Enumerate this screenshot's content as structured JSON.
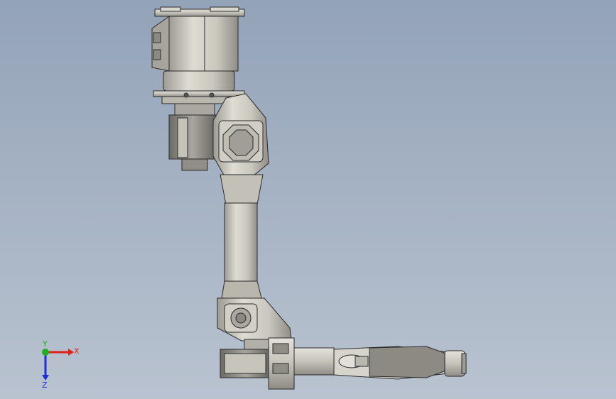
{
  "viewport": {
    "background_top": "#93a3b8",
    "background_bottom": "#b9c3d0"
  },
  "model": {
    "body_color": "#c9c7be",
    "edge_color": "#2b2b2b",
    "shadow_color": "#8c8a82"
  },
  "triad": {
    "x_label": "X",
    "y_label": "Y",
    "z_label": "Z",
    "x_color": "#e0201b",
    "y_color": "#20b020",
    "z_color": "#2030d0"
  }
}
